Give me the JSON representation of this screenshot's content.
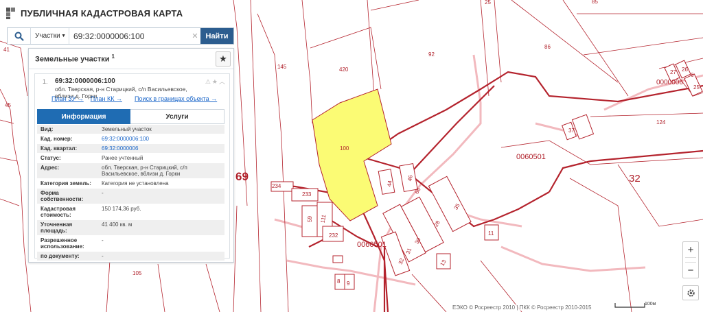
{
  "app": {
    "title": "ПУБЛИЧНАЯ КАДАСТРОВАЯ КАРТА"
  },
  "search": {
    "type_label": "Участки",
    "query": "69:32:0000006:100",
    "find_label": "Найти"
  },
  "panel": {
    "title": "Земельные участки",
    "count": "1",
    "item": {
      "number": "1.",
      "cad_number": "69:32:0000006:100",
      "address": "обл. Тверская, р-н Старицкий, с/п Васильевское, вблизи д. Горки"
    },
    "links": {
      "plan_zu": "План ЗУ →",
      "plan_kk": "План КК →",
      "search_bounds": "Поиск в границах объекта →"
    },
    "tabs": {
      "info": "Информация",
      "services": "Услуги"
    },
    "attributes": [
      {
        "key": "Вид:",
        "value": "Земельный участок"
      },
      {
        "key": "Кад. номер:",
        "value": "69:32:0000006:100"
      },
      {
        "key": "Кад. квартал:",
        "value": "69:32:0000006"
      },
      {
        "key": "Статус:",
        "value": "Ранее учтенный"
      },
      {
        "key": "Адрес:",
        "value": "обл. Тверская, р-н Старицкий, с/п Васильевское, вблизи д. Горки"
      },
      {
        "key": "Категория земель:",
        "value": "Категория не установлена"
      },
      {
        "key": "Форма собственности:",
        "value": "-"
      },
      {
        "key": "Кадастровая стоимость:",
        "value": "150 174,36 руб."
      },
      {
        "key": "Уточненная площадь:",
        "value": "41 400 кв. м"
      },
      {
        "key": "Разрешенное использование:",
        "value": "-"
      },
      {
        "key": "по документу:",
        "value": "-"
      }
    ]
  },
  "map": {
    "labels": {
      "p85": "85",
      "p92": "92",
      "p86": "86",
      "p420": "420",
      "p145": "145",
      "p100": "100",
      "p124": "124",
      "p0000006": "0000006",
      "p0060501": "0060501",
      "p0060501b": "0060501",
      "p32": "32",
      "p69": "69",
      "p234": "234",
      "p233": "233",
      "p232": "232",
      "p105": "105",
      "p45": "45",
      "p41": "41",
      "p25a": "25",
      "p25b": "25",
      "p27": "27",
      "p26": "26",
      "p6": "6",
      "p37": "37",
      "p44": "44",
      "p46": "46",
      "p66": "66",
      "p35": "35",
      "p28": "28",
      "p30": "30",
      "p31": "31",
      "p32s": "32",
      "p13": "13",
      "p11": "11",
      "p59": "59",
      "p111": "111",
      "p8": "8",
      "p9": "9"
    },
    "colors": {
      "boundary": "#b4232d",
      "road": "#f2b9be",
      "selected_fill": "#fbfb74"
    },
    "attribution": "ЕЭКО © Росреестр 2010 | ПКК © Росреестр 2010-2015",
    "scale_label": "100м"
  },
  "controls": {
    "zoom_in": "+",
    "zoom_out": "−"
  }
}
